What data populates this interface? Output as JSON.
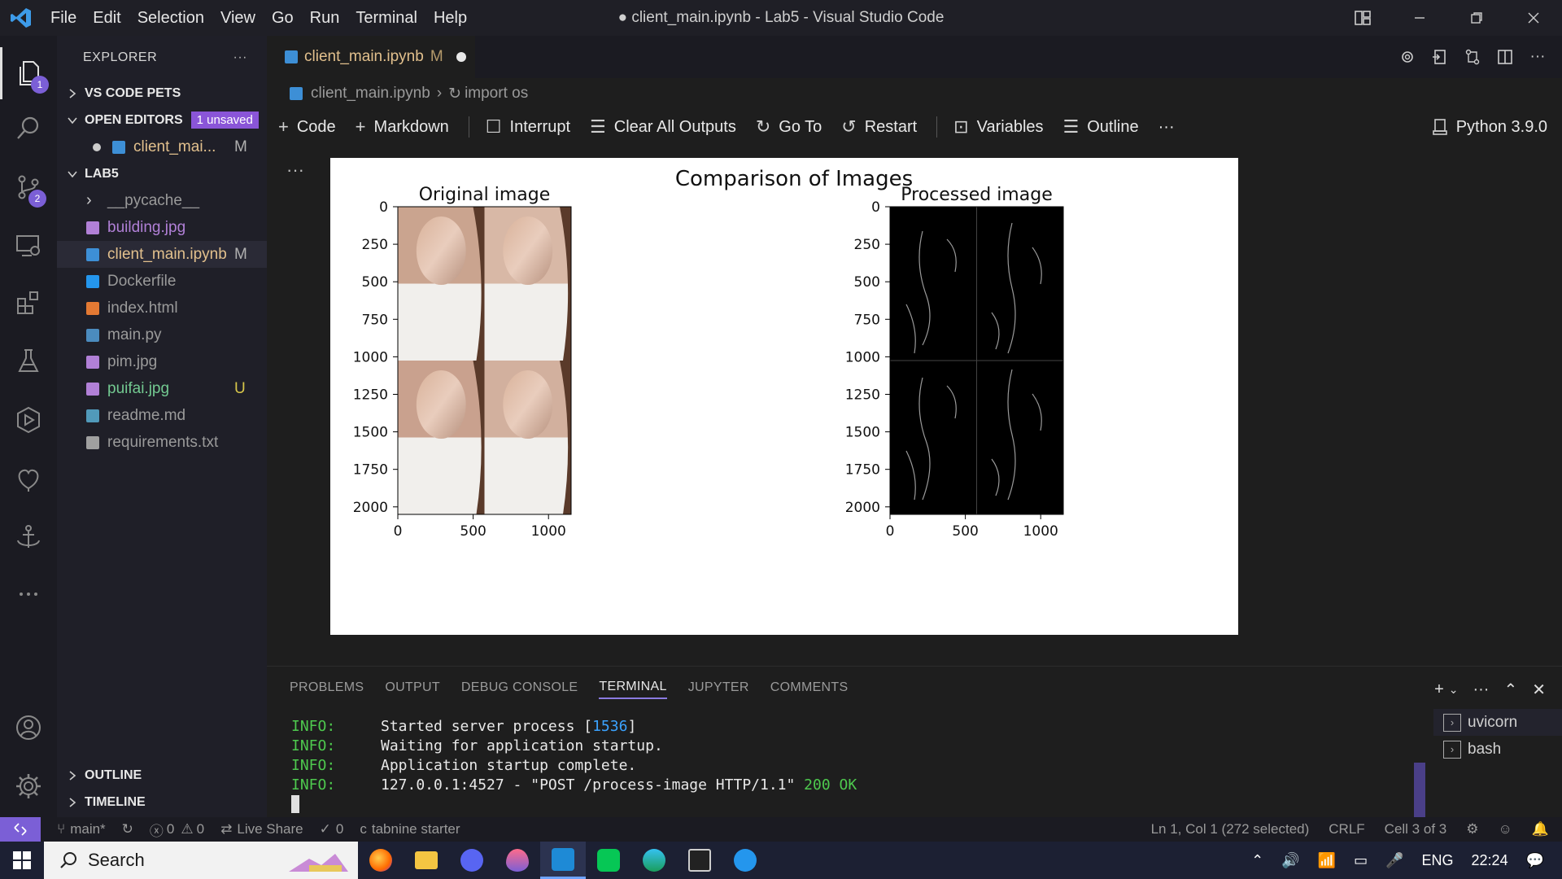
{
  "window": {
    "title": "● client_main.ipynb - Lab5 - Visual Studio Code",
    "menu": [
      "File",
      "Edit",
      "Selection",
      "View",
      "Go",
      "Run",
      "Terminal",
      "Help"
    ]
  },
  "activity": {
    "explorer_badge": "1",
    "scm_badge": "2"
  },
  "sidebar": {
    "title": "EXPLORER",
    "more": "···",
    "sections": {
      "pets": "VS CODE PETS",
      "open_editors": "OPEN EDITORS",
      "unsaved_badge": "1 unsaved",
      "open_file": "client_mai...",
      "open_file_status": "M",
      "project": "LAB5",
      "outline": "OUTLINE",
      "timeline": "TIMELINE"
    },
    "files": [
      {
        "name": "__pycache__",
        "status": "",
        "color": "#9a9a9a",
        "icon": "folder-chevron"
      },
      {
        "name": "building.jpg",
        "status": "",
        "color": "#b180d7",
        "icon": "image-icon"
      },
      {
        "name": "client_main.ipynb",
        "status": "M",
        "color": "#e2c08d",
        "icon": "notebook-icon"
      },
      {
        "name": "Dockerfile",
        "status": "",
        "color": "#9a9a9a",
        "icon": "docker-icon"
      },
      {
        "name": "index.html",
        "status": "",
        "color": "#9a9a9a",
        "icon": "html-icon"
      },
      {
        "name": "main.py",
        "status": "",
        "color": "#9a9a9a",
        "icon": "python-icon"
      },
      {
        "name": "pim.jpg",
        "status": "",
        "color": "#9a9a9a",
        "icon": "image-icon"
      },
      {
        "name": "puifai.jpg",
        "status": "U",
        "color": "#73c991",
        "icon": "image-icon"
      },
      {
        "name": "readme.md",
        "status": "",
        "color": "#9a9a9a",
        "icon": "info-icon"
      },
      {
        "name": "requirements.txt",
        "status": "",
        "color": "#9a9a9a",
        "icon": "text-icon"
      }
    ]
  },
  "editor": {
    "tab": {
      "label": "client_main.ipynb",
      "status": "M"
    },
    "breadcrumb": [
      "client_main.ipynb",
      "import os"
    ],
    "toolbar": {
      "code": "Code",
      "markdown": "Markdown",
      "interrupt": "Interrupt",
      "clear": "Clear All Outputs",
      "goto": "Go To",
      "restart": "Restart",
      "variables": "Variables",
      "outline": "Outline",
      "more": "···",
      "kernel": "Python 3.9.0"
    },
    "cell_more": "···"
  },
  "chart_data": {
    "type": "image-comparison",
    "title": "Comparison of Images",
    "subplots": [
      {
        "name": "Original image",
        "xticks": [
          "0",
          "500",
          "1000"
        ],
        "yticks": [
          "0",
          "250",
          "500",
          "750",
          "1000",
          "1250",
          "1500",
          "1750",
          "2000"
        ],
        "xlim": [
          0,
          1150
        ],
        "ylim": [
          2050,
          0
        ]
      },
      {
        "name": "Processed image",
        "xticks": [
          "0",
          "500",
          "1000"
        ],
        "yticks": [
          "0",
          "250",
          "500",
          "750",
          "1000",
          "1250",
          "1500",
          "1750",
          "2000"
        ],
        "xlim": [
          0,
          1150
        ],
        "ylim": [
          2050,
          0
        ]
      }
    ]
  },
  "panel": {
    "tabs": [
      "PROBLEMS",
      "OUTPUT",
      "DEBUG CONSOLE",
      "TERMINAL",
      "JUPYTER",
      "COMMENTS"
    ],
    "active_tab": "TERMINAL",
    "terminal_lines": [
      {
        "level": "INFO:",
        "text": "Started server process [",
        "num": "1536",
        "tail": "]"
      },
      {
        "level": "INFO:",
        "text": "Waiting for application startup."
      },
      {
        "level": "INFO:",
        "text": "Application startup complete."
      },
      {
        "level": "INFO:",
        "text": "127.0.0.1:4527 - \"POST /process-image HTTP/1.1\" ",
        "num": "200",
        "tail": " OK"
      }
    ],
    "terminals": [
      "uvicorn",
      "bash"
    ]
  },
  "statusbar": {
    "branch": "main*",
    "errors": "0",
    "warnings": "0",
    "liveshare": "Live Share",
    "ports": "0",
    "tabnine": "tabnine starter",
    "position": "Ln 1, Col 1 (272 selected)",
    "eol": "CRLF",
    "cell": "Cell 3 of 3"
  },
  "taskbar": {
    "search": "Search",
    "lang": "ENG",
    "time": "22:24"
  }
}
